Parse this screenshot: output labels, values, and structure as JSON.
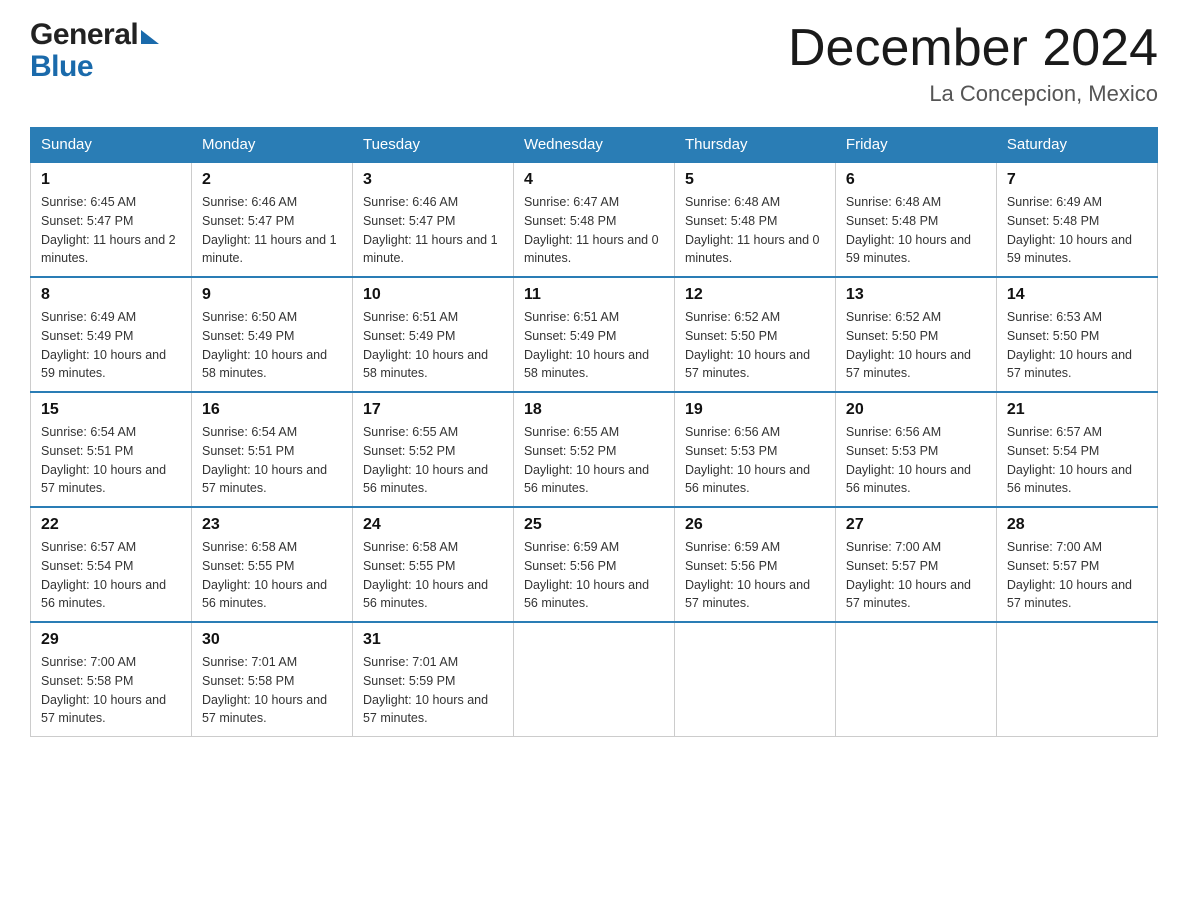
{
  "header": {
    "logo_general": "General",
    "logo_blue": "Blue",
    "month_title": "December 2024",
    "location": "La Concepcion, Mexico"
  },
  "weekdays": [
    "Sunday",
    "Monday",
    "Tuesday",
    "Wednesday",
    "Thursday",
    "Friday",
    "Saturday"
  ],
  "weeks": [
    [
      {
        "day": "1",
        "sunrise": "6:45 AM",
        "sunset": "5:47 PM",
        "daylight": "11 hours and 2 minutes."
      },
      {
        "day": "2",
        "sunrise": "6:46 AM",
        "sunset": "5:47 PM",
        "daylight": "11 hours and 1 minute."
      },
      {
        "day": "3",
        "sunrise": "6:46 AM",
        "sunset": "5:47 PM",
        "daylight": "11 hours and 1 minute."
      },
      {
        "day": "4",
        "sunrise": "6:47 AM",
        "sunset": "5:48 PM",
        "daylight": "11 hours and 0 minutes."
      },
      {
        "day": "5",
        "sunrise": "6:48 AM",
        "sunset": "5:48 PM",
        "daylight": "11 hours and 0 minutes."
      },
      {
        "day": "6",
        "sunrise": "6:48 AM",
        "sunset": "5:48 PM",
        "daylight": "10 hours and 59 minutes."
      },
      {
        "day": "7",
        "sunrise": "6:49 AM",
        "sunset": "5:48 PM",
        "daylight": "10 hours and 59 minutes."
      }
    ],
    [
      {
        "day": "8",
        "sunrise": "6:49 AM",
        "sunset": "5:49 PM",
        "daylight": "10 hours and 59 minutes."
      },
      {
        "day": "9",
        "sunrise": "6:50 AM",
        "sunset": "5:49 PM",
        "daylight": "10 hours and 58 minutes."
      },
      {
        "day": "10",
        "sunrise": "6:51 AM",
        "sunset": "5:49 PM",
        "daylight": "10 hours and 58 minutes."
      },
      {
        "day": "11",
        "sunrise": "6:51 AM",
        "sunset": "5:49 PM",
        "daylight": "10 hours and 58 minutes."
      },
      {
        "day": "12",
        "sunrise": "6:52 AM",
        "sunset": "5:50 PM",
        "daylight": "10 hours and 57 minutes."
      },
      {
        "day": "13",
        "sunrise": "6:52 AM",
        "sunset": "5:50 PM",
        "daylight": "10 hours and 57 minutes."
      },
      {
        "day": "14",
        "sunrise": "6:53 AM",
        "sunset": "5:50 PM",
        "daylight": "10 hours and 57 minutes."
      }
    ],
    [
      {
        "day": "15",
        "sunrise": "6:54 AM",
        "sunset": "5:51 PM",
        "daylight": "10 hours and 57 minutes."
      },
      {
        "day": "16",
        "sunrise": "6:54 AM",
        "sunset": "5:51 PM",
        "daylight": "10 hours and 57 minutes."
      },
      {
        "day": "17",
        "sunrise": "6:55 AM",
        "sunset": "5:52 PM",
        "daylight": "10 hours and 56 minutes."
      },
      {
        "day": "18",
        "sunrise": "6:55 AM",
        "sunset": "5:52 PM",
        "daylight": "10 hours and 56 minutes."
      },
      {
        "day": "19",
        "sunrise": "6:56 AM",
        "sunset": "5:53 PM",
        "daylight": "10 hours and 56 minutes."
      },
      {
        "day": "20",
        "sunrise": "6:56 AM",
        "sunset": "5:53 PM",
        "daylight": "10 hours and 56 minutes."
      },
      {
        "day": "21",
        "sunrise": "6:57 AM",
        "sunset": "5:54 PM",
        "daylight": "10 hours and 56 minutes."
      }
    ],
    [
      {
        "day": "22",
        "sunrise": "6:57 AM",
        "sunset": "5:54 PM",
        "daylight": "10 hours and 56 minutes."
      },
      {
        "day": "23",
        "sunrise": "6:58 AM",
        "sunset": "5:55 PM",
        "daylight": "10 hours and 56 minutes."
      },
      {
        "day": "24",
        "sunrise": "6:58 AM",
        "sunset": "5:55 PM",
        "daylight": "10 hours and 56 minutes."
      },
      {
        "day": "25",
        "sunrise": "6:59 AM",
        "sunset": "5:56 PM",
        "daylight": "10 hours and 56 minutes."
      },
      {
        "day": "26",
        "sunrise": "6:59 AM",
        "sunset": "5:56 PM",
        "daylight": "10 hours and 57 minutes."
      },
      {
        "day": "27",
        "sunrise": "7:00 AM",
        "sunset": "5:57 PM",
        "daylight": "10 hours and 57 minutes."
      },
      {
        "day": "28",
        "sunrise": "7:00 AM",
        "sunset": "5:57 PM",
        "daylight": "10 hours and 57 minutes."
      }
    ],
    [
      {
        "day": "29",
        "sunrise": "7:00 AM",
        "sunset": "5:58 PM",
        "daylight": "10 hours and 57 minutes."
      },
      {
        "day": "30",
        "sunrise": "7:01 AM",
        "sunset": "5:58 PM",
        "daylight": "10 hours and 57 minutes."
      },
      {
        "day": "31",
        "sunrise": "7:01 AM",
        "sunset": "5:59 PM",
        "daylight": "10 hours and 57 minutes."
      },
      null,
      null,
      null,
      null
    ]
  ]
}
